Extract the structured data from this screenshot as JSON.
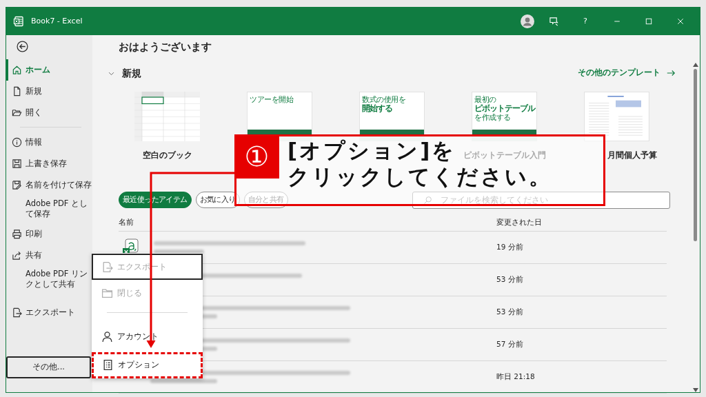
{
  "window": {
    "title": "Book7 - Excel",
    "help": "?"
  },
  "sidebar": {
    "items": [
      {
        "label": "ホーム",
        "selected": true
      },
      {
        "label": "新規",
        "selected": false
      },
      {
        "label": "開く",
        "selected": false
      },
      {
        "label": "情報",
        "selected": false
      },
      {
        "label": "上書き保存",
        "selected": false
      },
      {
        "label": "名前を付けて保存",
        "selected": false
      },
      {
        "label": "Adobe PDF として保存",
        "selected": false
      },
      {
        "label": "印刷",
        "selected": false
      },
      {
        "label": "共有",
        "selected": false
      },
      {
        "label": "Adobe PDF リンクとして共有",
        "selected": false
      },
      {
        "label": "エクスポート",
        "selected": false
      }
    ],
    "more": {
      "label": "その他...",
      "expanded": true
    }
  },
  "greeting": "おはようございます",
  "new_section": {
    "title": "新規",
    "expanded": true,
    "more_templates": "その他のテンプレート",
    "templates": [
      {
        "kind": "blank",
        "label": "空白のブック"
      },
      {
        "kind": "cover",
        "thumb_lines": [
          {
            "text": "ツアーを開始",
            "emphasis": false
          }
        ]
      },
      {
        "kind": "cover",
        "thumb_lines": [
          {
            "text": "数式の使用を",
            "emphasis": false
          },
          {
            "text": "開始する",
            "emphasis": true
          }
        ]
      },
      {
        "kind": "cover",
        "thumb_lines": [
          {
            "text": "最初の",
            "emphasis": false
          },
          {
            "text": "ピボットテーブル",
            "emphasis": true
          },
          {
            "text": "を作成する",
            "emphasis": false
          }
        ],
        "label": "ピボットテーブル入門"
      },
      {
        "kind": "document",
        "label": "月間個人予算"
      }
    ]
  },
  "filters": [
    {
      "label": "最近使ったアイテム",
      "selected": true
    },
    {
      "label": "お気に入り",
      "selected": false
    },
    {
      "label": "自分と共有",
      "selected": false
    }
  ],
  "search": {
    "placeholder": "ファイルを検索してください"
  },
  "files": {
    "columns": [
      "名前",
      "変更された日"
    ],
    "rows": [
      {
        "modified": "19 分前"
      },
      {
        "modified": "53 分前"
      },
      {
        "modified": "53 分前"
      },
      {
        "modified": "57 分前"
      },
      {
        "modified": "昨日 21:18"
      }
    ]
  },
  "more_menu": {
    "items": [
      {
        "label": "エクスポート",
        "disabled": true,
        "focused": true,
        "highlighted": false
      },
      {
        "label": "閉じる",
        "disabled": true,
        "focused": false,
        "highlighted": false
      },
      {
        "label": "アカウント",
        "disabled": false,
        "focused": false,
        "highlighted": false
      },
      {
        "label": "オプション",
        "disabled": false,
        "focused": false,
        "highlighted": true
      }
    ]
  },
  "annotation": {
    "number": "①",
    "lines": [
      "[オプション]を",
      "クリックしてください。"
    ]
  }
}
